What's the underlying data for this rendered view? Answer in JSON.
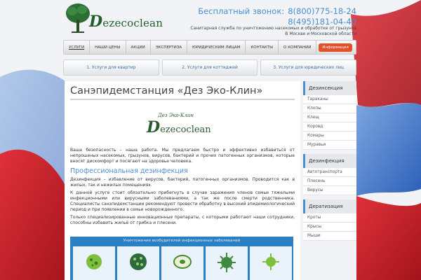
{
  "header": {
    "logo_initial": "D",
    "logo_rest": "ezecoclean",
    "phone_label": "Бесплатный звонок:",
    "phone_free": "8(800)775-18-24",
    "phone_city": "8(495)181-04-40",
    "tagline_line1": "Санитарная служба по уничтожению насекомых и обработке от грызунов",
    "tagline_line2": "В Москве и Московской области"
  },
  "nav": {
    "items": [
      "Услуги",
      "Наши цены",
      "Акции",
      "Экспертиза",
      "Юридическим лицам",
      "Контакты",
      "О компании"
    ],
    "info_label": "Информация"
  },
  "service_tabs": [
    "1. Услуги для квартир",
    "2. Услуги для коттеджей",
    "3. Услуги для юридических лиц"
  ],
  "main": {
    "title": "Санэпидемстанция «Дез Эко-Клин»",
    "mini_logo_top": "Дез Эко-Клин",
    "mini_logo_initial": "D",
    "mini_logo_rest": "ezecoclean",
    "intro": "Ваша безопасность – наша работа. Мы предлагаем быстро и эффективно избавиться от непрошеных насекомых, грызунов, вирусов, бактерий и прочих патогенных организмов, которые вносят дискомфорт и посягают на здоровье человека.",
    "section_title": "Профессиональная дезинфекция",
    "para1": "Дезинфекция – избавление от вирусов, бактерий, патогенных организмов. Проводится как в жилых, так и нежилых помещениях.",
    "para2": "К данной услуге стоит обязательно прибегнуть в случае заражения членов семьи тяжелыми инфекционными или вирусными заболеваниями, а так же после смерти родственника. Специалисты санэпидемстанции рекомендуют провести обработку в высокий эпидемиологический период и при появлении в семье новорожденного.",
    "para3": "Только специализированные инновационные препараты, с которыми работают наши сотрудники, способны избавить жильё от грибка и плесени.",
    "banner_title": "Уничтожение возбудителей инфекционных заболеваний"
  },
  "sidebar": [
    {
      "title": "Дезинсекция",
      "items": [
        "Тараканы",
        "Клопы",
        "Клещ",
        "Коровд",
        "Комары",
        "Муравьи"
      ]
    },
    {
      "title": "Дезинфекция",
      "items": [
        "Автотранспорта",
        "Плесень",
        "Вирусы"
      ]
    },
    {
      "title": "Дератизация",
      "items": [
        "Кроты",
        "Крысы",
        "Мыши"
      ]
    }
  ],
  "colors": {
    "accent": "#4a8fd0",
    "brand_green": "#1f5e2a",
    "info_badge": "#e1512b",
    "banner": "#2b7fc3"
  }
}
